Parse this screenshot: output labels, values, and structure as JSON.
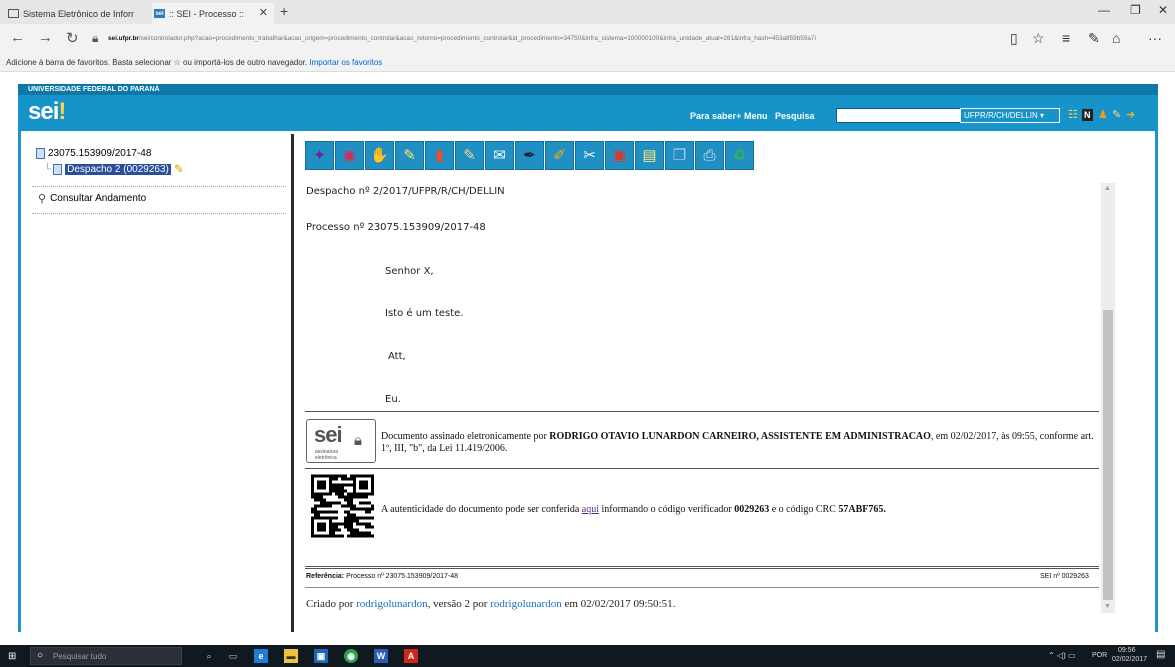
{
  "browser": {
    "tabs": [
      {
        "label": "Sistema Eletrônico de Inforr",
        "active": false
      },
      {
        "label": ":: SEI - Processo ::",
        "active": true
      }
    ],
    "url_host": "sei.ufpr.br",
    "url_rest": "/sei/controlador.php?acao=procedimento_trabalhar&acao_origem=procedimento_controlar&acao_retorno=procedimento_controlar&id_procedimento=34750&infra_sistema=100000100&infra_unidade_atual=261&infra_hash=453a859b59a7i",
    "favorites_text": "Adicione à barra de favoritos. Basta selecionar ☆ ou importá-los de outro navegador.",
    "favorites_link": "Importar os favoritos"
  },
  "sei": {
    "org_name": "UNIVERSIDADE FEDERAL DO PARANÁ",
    "logo_text": "sei",
    "logo_mark": "!",
    "links": {
      "para_saber": "Para saber+",
      "menu": "Menu",
      "pesquisa": "Pesquisa"
    },
    "search_value": "",
    "unit": "UFPR/R/CH/DELLIN"
  },
  "tree": {
    "process_number": "23075.153909/2017-48",
    "document_label": "Despacho 2 (0029263)",
    "consultar_label": "Consultar Andamento"
  },
  "toolbar": {
    "buttons": [
      {
        "icon": "people-icon",
        "glyph": "✦",
        "color": "#7a1f8a"
      },
      {
        "icon": "eye-icon",
        "glyph": "◉",
        "color": "#e0284c"
      },
      {
        "icon": "thumbs-icon",
        "glyph": "✋",
        "color": "#f3c48a"
      },
      {
        "icon": "pencil-doc-icon",
        "glyph": "✎",
        "color": "#ffe066"
      },
      {
        "icon": "book-icon",
        "glyph": "▮",
        "color": "#e8502e"
      },
      {
        "icon": "edit-doc-icon",
        "glyph": "✎",
        "color": "#f2d58a"
      },
      {
        "icon": "email-icon",
        "glyph": "✉",
        "color": "#ffffff"
      },
      {
        "icon": "sign-pen-icon",
        "glyph": "✒",
        "color": "#1b1b1b"
      },
      {
        "icon": "ruler-icon",
        "glyph": "✐",
        "color": "#ffb000"
      },
      {
        "icon": "cut-icon",
        "glyph": "✂",
        "color": "#fdfdfd"
      },
      {
        "icon": "package-icon",
        "glyph": "▣",
        "color": "#d93a2a"
      },
      {
        "icon": "new-doc-icon",
        "glyph": "▤",
        "color": "#ffe680"
      },
      {
        "icon": "copy-icon",
        "glyph": "❐",
        "color": "#b5c7e8"
      },
      {
        "icon": "print-icon",
        "glyph": "⎙",
        "color": "#e3e3e3"
      },
      {
        "icon": "trash-icon",
        "glyph": "♻",
        "color": "#3bb54a"
      }
    ]
  },
  "document": {
    "title_line": "Despacho nº 2/2017/UFPR/R/CH/DELLIN",
    "process_line": "Processo nº 23075.153909/2017-48",
    "salutation": "Senhor X,",
    "body": "Isto é um teste.",
    "closing": "Att,",
    "author": "Eu.",
    "badge_word": "sei",
    "badge_sub": "assinatura eletrônica",
    "signature_prefix": "Documento assinado eletronicamente por",
    "signer": "RODRIGO OTAVIO LUNARDON CARNEIRO, ASSISTENTE EM ADMINISTRACAO",
    "signature_suffix": ", em 02/02/2017, às 09:55, conforme art. 1º, III, \"b\", da Lei 11.419/2006.",
    "auth_prefix": "A autenticidade do documento pode ser conferida",
    "auth_link": "aqui",
    "auth_middle": "informando o código verificador",
    "verifier_code": "0029263",
    "auth_crc_text": "e o código CRC",
    "crc": "57ABF765.",
    "reference_label": "Referência:",
    "reference_value": "Processo nº 23075.153909/2017-48",
    "sei_number": "SEI nº 0029263"
  },
  "footer": {
    "created_by_text": "Criado por",
    "creator": "rodrigolunardon",
    "version_text": ", versão 2 por",
    "editor": "rodrigolunardon",
    "date_text": "em 02/02/2017 09:50:51."
  },
  "taskbar": {
    "search_placeholder": "Pesquisar tudo",
    "language": "POR",
    "time": "09:56",
    "date": "02/02/2017"
  }
}
